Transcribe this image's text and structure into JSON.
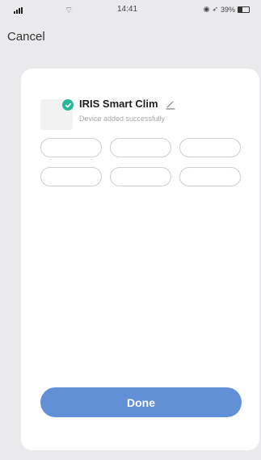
{
  "status_bar": {
    "time": "14:41",
    "battery_level": "39%",
    "wifi_icon": "wifi-icon"
  },
  "nav": {
    "cancel_label": "Cancel"
  },
  "device": {
    "name": "IRIS Smart Clim",
    "status": "Device added successfully",
    "check_icon": "check-circle-icon",
    "edit_icon": "pencil-icon"
  },
  "room_options": [
    "",
    "",
    "",
    "",
    "",
    ""
  ],
  "done_label": "Done",
  "colors": {
    "accent": "#6290d6",
    "success": "#2bb89a",
    "background": "#eaeaed",
    "card": "#ffffff"
  }
}
